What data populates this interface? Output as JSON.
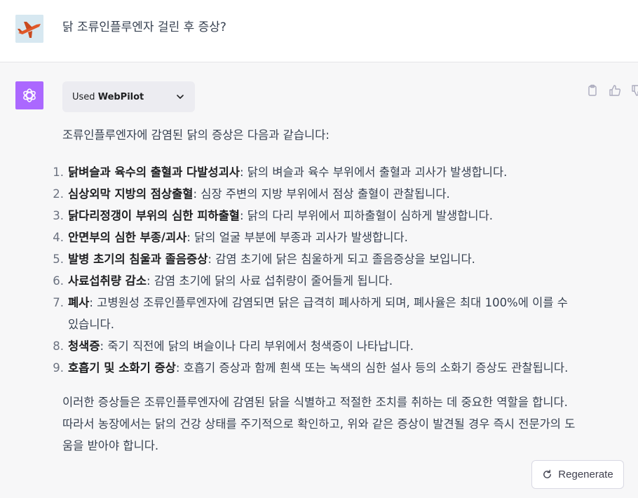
{
  "user": {
    "question": "닭 조류인플루엔자 걸린 후 증상?"
  },
  "plugin": {
    "used_label": "Used",
    "plugin_name": "WebPilot"
  },
  "answer": {
    "intro": "조류인플루엔자에 감염된 닭의 증상은 다음과 같습니다:",
    "items": [
      {
        "num": "1.",
        "title": "닭벼슬과 육수의 출혈과 다발성괴사",
        "text": ": 닭의 벼슬과 육수 부위에서 출혈과 괴사가 발생합니다."
      },
      {
        "num": "2.",
        "title": "심상외막 지방의 점상출혈",
        "text": ": 심장 주변의 지방 부위에서 점상 출혈이 관찰됩니다."
      },
      {
        "num": "3.",
        "title": "닭다리정갱이 부위의 심한 피하출혈",
        "text": ": 닭의 다리 부위에서 피하출혈이 심하게 발생합니다."
      },
      {
        "num": "4.",
        "title": "안면부의 심한 부종/괴사",
        "text": ": 닭의 얼굴 부분에 부종과 괴사가 발생합니다."
      },
      {
        "num": "5.",
        "title": "발병 초기의 침울과 졸음증상",
        "text": ": 감염 초기에 닭은 침울하게 되고 졸음증상을 보입니다."
      },
      {
        "num": "6.",
        "title": "사료섭취량 감소",
        "text": ": 감염 초기에 닭의 사료 섭취량이 줄어들게 됩니다."
      },
      {
        "num": "7.",
        "title": "폐사",
        "text": ": 고병원성 조류인플루엔자에 감염되면 닭은 급격히 폐사하게 되며, 폐사율은 최대 100%에 이를 수 있습니다."
      },
      {
        "num": "8.",
        "title": "청색증",
        "text": ": 죽기 직전에 닭의 벼슬이나 다리 부위에서 청색증이 나타납니다."
      },
      {
        "num": "9.",
        "title": "호흡기 및 소화기 증상",
        "text": ": 호흡기 증상과 함께 흰색 또는 녹색의 심한 설사 등의 소화기 증상도 관찰됩니다."
      }
    ],
    "conclusion": "이러한 증상들은 조류인플루엔자에 감염된 닭을 식별하고 적절한 조치를 취하는 데 중요한 역할을 합니다. 따라서 농장에서는 닭의 건강 상태를 주기적으로 확인하고, 위와 같은 증상이 발견될 경우 즉시 전문가의 도움을 받아야 합니다."
  },
  "regenerate_label": "Regenerate",
  "icons": {
    "copy": "clipboard-icon",
    "like": "thumbs-up-icon",
    "dislike": "thumbs-down-icon",
    "regen": "refresh-icon",
    "brand": "openai-logo-icon"
  },
  "colors": {
    "brand_purple": "#ab68ff",
    "assistant_bg": "#f7f7f8"
  }
}
